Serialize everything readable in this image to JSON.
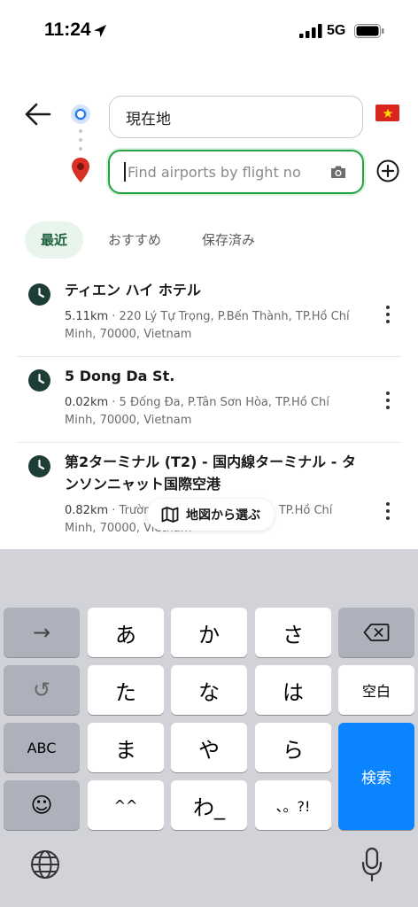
{
  "status_bar": {
    "time": "11:24",
    "network": "5G"
  },
  "route": {
    "origin_value": "現在地",
    "destination_placeholder": "Find airports by flight no"
  },
  "tabs": [
    {
      "label": "最近",
      "active": true
    },
    {
      "label": "おすすめ",
      "active": false
    },
    {
      "label": "保存済み",
      "active": false
    }
  ],
  "results": [
    {
      "title": "ティエン ハイ ホテル",
      "distance": "5.11km",
      "address": "220 Lý Tự Trọng, P.Bến Thành, TP.Hồ Chí Minh, 70000, Vietnam"
    },
    {
      "title": "5 Dong Da St.",
      "distance": "0.02km",
      "address": "5 Đống Đa, P.Tân Sơn Hòa, TP.Hồ Chí Minh, 70000, Vietnam"
    },
    {
      "title": "第2ターミナル (T2) - 国内線ターミナル - タンソンニャット国際空港",
      "distance": "0.82km",
      "address": "Trường Sơn, P.Tân Sơn Hòa, TP.Hồ Chí Minh, 70000, Vietnam"
    }
  ],
  "map_pick_label": "地図から選ぶ",
  "keyboard": {
    "row1": [
      "→",
      "あ",
      "か",
      "さ",
      "⌫"
    ],
    "row2": [
      "↺",
      "た",
      "な",
      "は",
      "空白"
    ],
    "row3": [
      "ABC",
      "ま",
      "や",
      "ら"
    ],
    "row4": [
      "☺",
      "^^",
      "わ_",
      "、。?!"
    ],
    "search_label": "検索"
  },
  "colors": {
    "accent_green": "#27a245",
    "route_blue": "#1a73e8",
    "keyboard_blue": "#0a84ff",
    "clock_dark": "#1e3d36"
  }
}
